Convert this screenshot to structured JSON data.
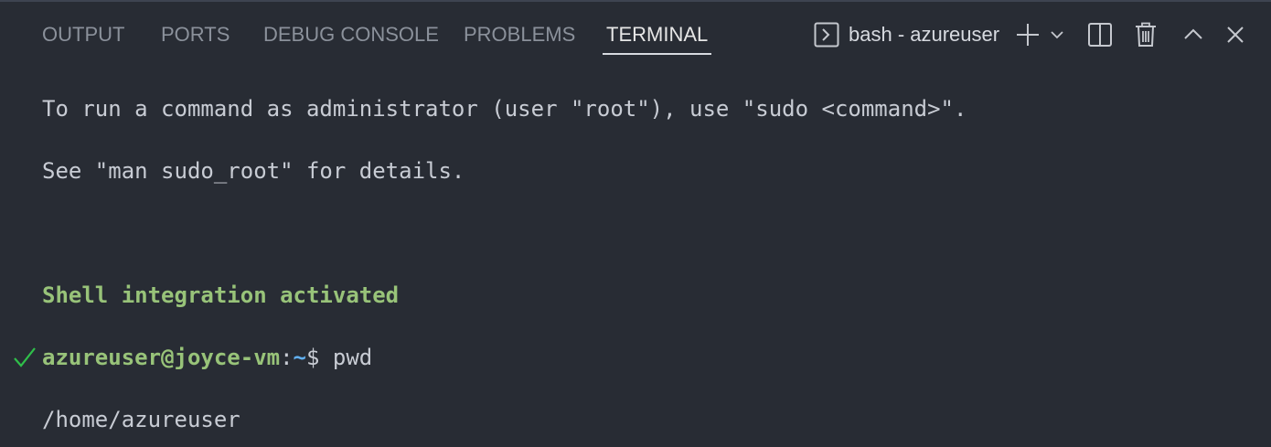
{
  "tabs": [
    {
      "label": "OUTPUT"
    },
    {
      "label": "PORTS"
    },
    {
      "label": "DEBUG CONSOLE"
    },
    {
      "label": "PROBLEMS"
    },
    {
      "label": "TERMINAL",
      "active": true
    }
  ],
  "toolbar": {
    "terminal_name": "bash - azureuser",
    "icons": [
      "terminal-icon",
      "plus-icon",
      "chevron-down-icon",
      "split-icon",
      "trash-icon",
      "chevron-up-icon",
      "close-icon"
    ]
  },
  "terminal": {
    "lines": {
      "sudo_hint": "To run a command as administrator (user \"root\"), use \"sudo <command>\".",
      "man_hint": "See \"man sudo_root\" for details.",
      "shell_integration": "Shell integration activated",
      "prompt_user_host": "azureuser@joyce-vm",
      "prompt_colon": ":",
      "prompt_path": "~",
      "prompt_dollar": "$",
      "command": " pwd",
      "output": "/home/azureuser"
    },
    "command_status": "success"
  },
  "colors": {
    "background": "#282c34",
    "green": "#98c379",
    "blue": "#61afef",
    "check": "#2fbf4a"
  }
}
